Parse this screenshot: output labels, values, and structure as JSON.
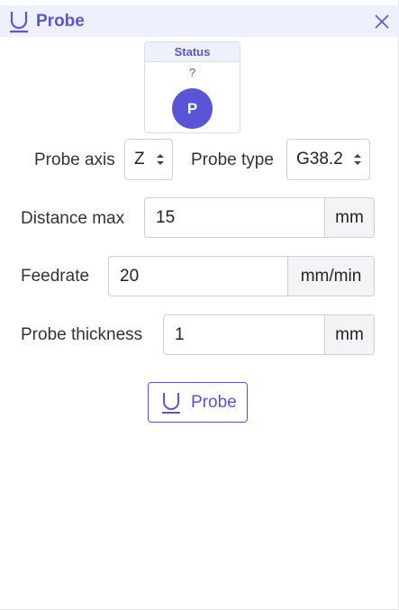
{
  "header": {
    "title": "Probe",
    "icon": "probe-u-icon",
    "close_icon": "close-icon"
  },
  "status": {
    "title": "Status",
    "value": "?",
    "badge": "P"
  },
  "form": {
    "probe_axis": {
      "label": "Probe axis",
      "value": "Z"
    },
    "probe_type": {
      "label": "Probe type",
      "value": "G38.2"
    },
    "distance_max": {
      "label": "Distance max",
      "value": "15",
      "unit": "mm"
    },
    "feedrate": {
      "label": "Feedrate",
      "value": "20",
      "unit": "mm/min"
    },
    "probe_thickness": {
      "label": "Probe thickness",
      "value": "1",
      "unit": "mm"
    }
  },
  "action": {
    "probe_label": "Probe"
  },
  "colors": {
    "accent": "#5a55d6",
    "header_bg": "#eef0fb",
    "border": "#cfcfd6",
    "unit_bg": "#f4f4f6"
  }
}
